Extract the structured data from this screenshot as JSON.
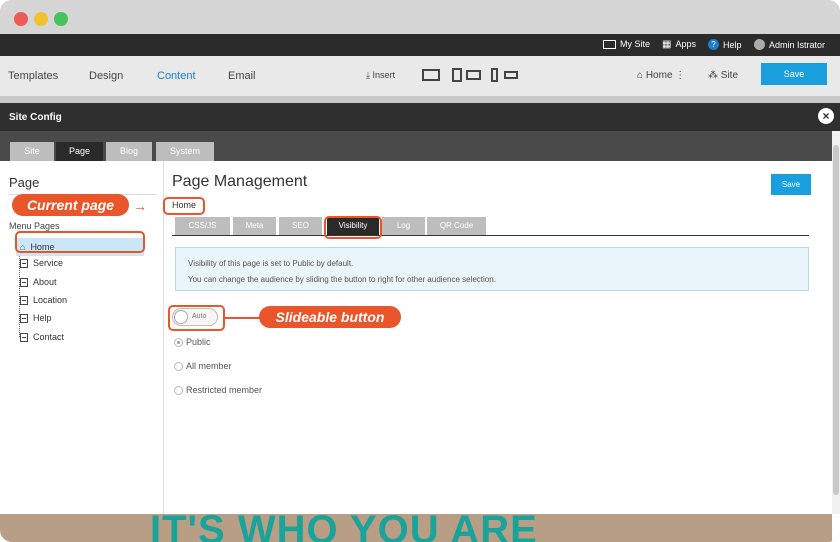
{
  "topbar": {
    "my_site": "My Site",
    "apps": "Apps",
    "help": "Help",
    "user": "Admin Istrator"
  },
  "editbar": {
    "tabs": [
      "Templates",
      "Design",
      "Content",
      "Email"
    ],
    "insert": "Insert",
    "home": "Home",
    "site": "Site",
    "save": "Save"
  },
  "modal": {
    "title": "Site Config",
    "tabs": [
      "Site",
      "Page",
      "Blog",
      "System"
    ]
  },
  "sidebar": {
    "heading": "Page",
    "menu_label": "Menu Pages",
    "items": [
      "Home",
      "Service",
      "About",
      "Location",
      "Help",
      "Contact"
    ]
  },
  "main": {
    "title": "Page Management",
    "save": "Save",
    "breadcrumb": "Home",
    "tabs": [
      "CSS/JS",
      "Meta",
      "SEO",
      "Visibility",
      "Log",
      "QR Code"
    ],
    "info_line1": "Visibility of this page is set to Public by default.",
    "info_line2": "You can change the audience by sliding the button to right for other audience selection.",
    "toggle_label": "Auto",
    "options": [
      "Public",
      "All member",
      "Restricted member"
    ]
  },
  "callouts": {
    "current_page": "Current page",
    "slideable": "Slideable button"
  },
  "background_text": "IT'S WHO YOU ARE",
  "colors": {
    "accent": "#1a9fde",
    "callout": "#e8562a",
    "content_tab": "#1a7fc8"
  }
}
